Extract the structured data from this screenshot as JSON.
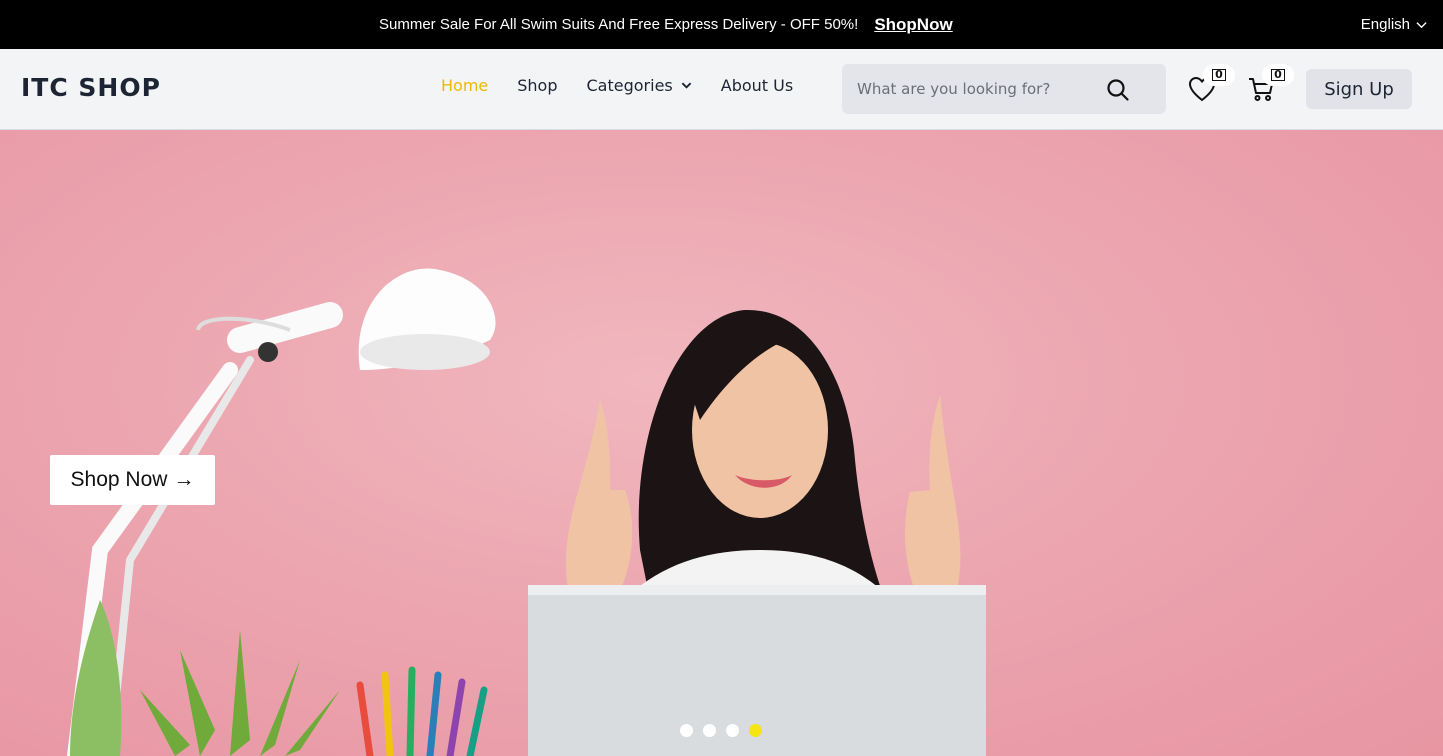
{
  "promo": {
    "text": "Summer Sale For All Swim Suits And Free Express Delivery - OFF 50%!",
    "link": "ShopNow"
  },
  "language": {
    "selected": "English"
  },
  "header": {
    "logo": "ITC SHOP",
    "nav": [
      {
        "label": "Home",
        "active": true
      },
      {
        "label": "Shop",
        "active": false
      },
      {
        "label": "Categories",
        "active": false,
        "dropdown": true
      },
      {
        "label": "About Us",
        "active": false
      }
    ],
    "search": {
      "placeholder": "What are you looking for?"
    },
    "wishlist_count": "0",
    "cart_count": "0",
    "signup_label": "Sign Up"
  },
  "hero": {
    "cta_label": "Shop Now",
    "cta_arrow": "→",
    "slides": 4,
    "active_slide": 4
  },
  "colors": {
    "accent": "#f2b705",
    "hero_bg": "#eca6b0",
    "active_dot": "#f5e514"
  }
}
